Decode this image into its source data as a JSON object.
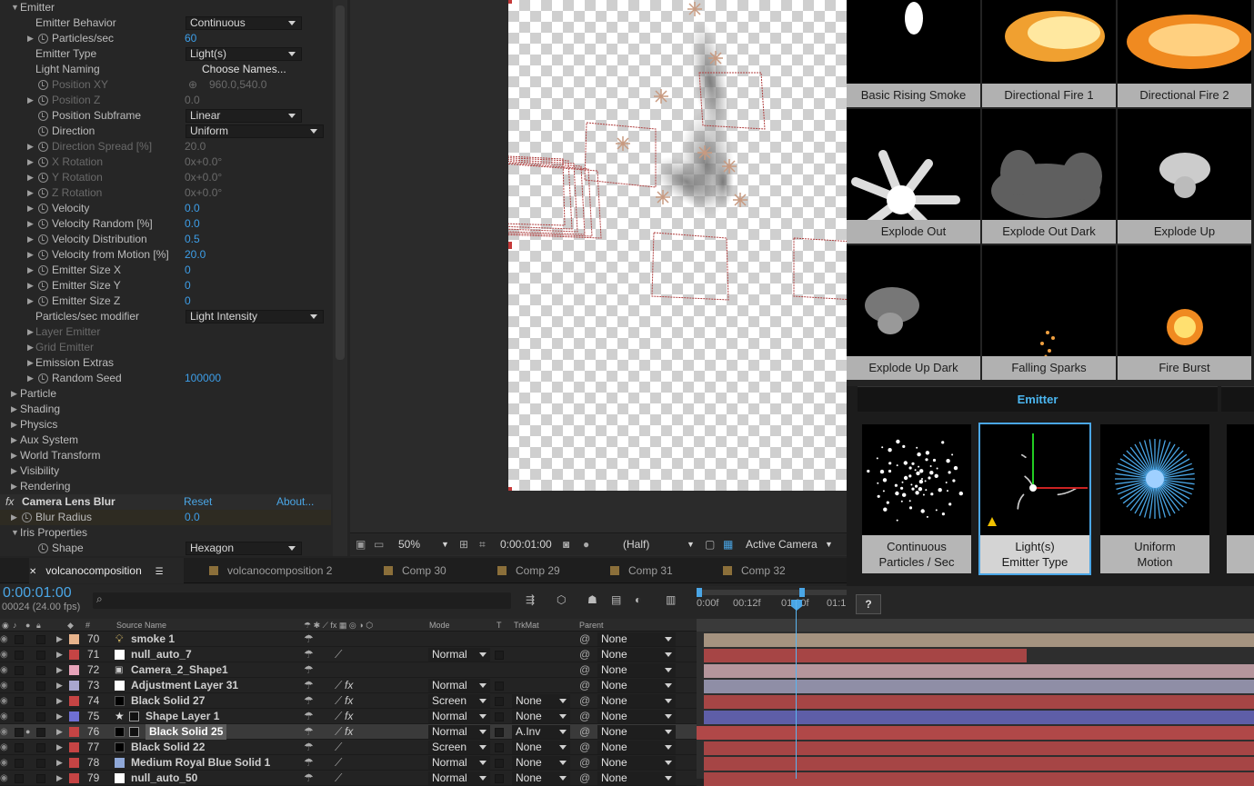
{
  "effect_controls": {
    "rows": [
      {
        "label": "Emitter",
        "twirl": "open",
        "indent": 0,
        "stopwatch": false
      },
      {
        "label": "Emitter Behavior",
        "indent": 2,
        "dropdown": "Continuous"
      },
      {
        "label": "Particles/sec",
        "twirl": "closed",
        "indent": 1,
        "stopwatch": true,
        "value": "60",
        "value_style": "blue"
      },
      {
        "label": "Emitter Type",
        "indent": 2,
        "dropdown": "Light(s)"
      },
      {
        "label": "Light Naming",
        "indent": 2,
        "button": "Choose Names..."
      },
      {
        "label": "Position XY",
        "indent": 1,
        "stopwatch": true,
        "disabled": true,
        "value": "960.0,540.0",
        "value_style": "dim",
        "crosshair": true
      },
      {
        "label": "Position Z",
        "twirl": "closed",
        "indent": 1,
        "stopwatch": true,
        "disabled": true,
        "value": "0.0",
        "value_style": "dim"
      },
      {
        "label": "Position Subframe",
        "indent": 1,
        "stopwatch": true,
        "dropdown": "Linear"
      },
      {
        "label": "Direction",
        "indent": 1,
        "stopwatch": true,
        "dropdown": "Uniform"
      },
      {
        "label": "Direction Spread [%]",
        "twirl": "closed",
        "indent": 1,
        "stopwatch": true,
        "disabled": true,
        "value": "20.0",
        "value_style": "dim"
      },
      {
        "label": "X Rotation",
        "twirl": "closed",
        "indent": 1,
        "stopwatch": true,
        "disabled": true,
        "value": "0x+0.0°",
        "value_style": "dim"
      },
      {
        "label": "Y Rotation",
        "twirl": "closed",
        "indent": 1,
        "stopwatch": true,
        "disabled": true,
        "value": "0x+0.0°",
        "value_style": "dim"
      },
      {
        "label": "Z Rotation",
        "twirl": "closed",
        "indent": 1,
        "stopwatch": true,
        "disabled": true,
        "value": "0x+0.0°",
        "value_style": "dim"
      },
      {
        "label": "Velocity",
        "twirl": "closed",
        "indent": 1,
        "stopwatch": true,
        "value": "0.0",
        "value_style": "blue"
      },
      {
        "label": "Velocity Random [%]",
        "twirl": "closed",
        "indent": 1,
        "stopwatch": true,
        "value": "0.0",
        "value_style": "blue"
      },
      {
        "label": "Velocity Distribution",
        "twirl": "closed",
        "indent": 1,
        "stopwatch": true,
        "value": "0.5",
        "value_style": "blue"
      },
      {
        "label": "Velocity from Motion [%]",
        "twirl": "closed",
        "indent": 1,
        "stopwatch": true,
        "value": "20.0",
        "value_style": "blue"
      },
      {
        "label": "Emitter Size X",
        "twirl": "closed",
        "indent": 1,
        "stopwatch": true,
        "value": "0",
        "value_style": "blue"
      },
      {
        "label": "Emitter Size Y",
        "twirl": "closed",
        "indent": 1,
        "stopwatch": true,
        "value": "0",
        "value_style": "blue"
      },
      {
        "label": "Emitter Size Z",
        "twirl": "closed",
        "indent": 1,
        "stopwatch": true,
        "value": "0",
        "value_style": "blue"
      },
      {
        "label": "Particles/sec modifier",
        "indent": 2,
        "dropdown": "Light Intensity"
      },
      {
        "label": "Layer Emitter",
        "twirl": "closed",
        "indent": 2,
        "disabled": true
      },
      {
        "label": "Grid Emitter",
        "twirl": "closed",
        "indent": 2,
        "disabled": true
      },
      {
        "label": "Emission Extras",
        "twirl": "closed",
        "indent": 2
      },
      {
        "label": "Random Seed",
        "twirl": "closed",
        "indent": 1,
        "stopwatch": true,
        "value": "100000",
        "value_style": "blue"
      },
      {
        "label": "Particle",
        "twirl": "closed",
        "indent": 0
      },
      {
        "label": "Shading",
        "twirl": "closed",
        "indent": 0
      },
      {
        "label": "Physics",
        "twirl": "closed",
        "indent": 0
      },
      {
        "label": "Aux System",
        "twirl": "closed",
        "indent": 0
      },
      {
        "label": "World Transform",
        "twirl": "closed",
        "indent": 0
      },
      {
        "label": "Visibility",
        "twirl": "closed",
        "indent": 0
      },
      {
        "label": "Rendering",
        "twirl": "closed",
        "indent": 0
      },
      {
        "label": "Camera Lens Blur",
        "fx": true,
        "indent": 0,
        "reset": "Reset",
        "about": "About..."
      },
      {
        "label": "Blur Radius",
        "twirl": "closed",
        "indent": 0,
        "stopwatch": true,
        "value": "0.0",
        "value_style": "blue"
      },
      {
        "label": "Iris Properties",
        "twirl": "open",
        "indent": 0
      },
      {
        "label": "Shape",
        "indent": 1,
        "stopwatch": true,
        "dropdown": "Hexagon"
      }
    ]
  },
  "viewer": {
    "zoom": "50%",
    "timecode": "0:00:01:00",
    "resolution": "(Half)",
    "camera": "Active Camera"
  },
  "presets": [
    {
      "label": "Basic Rising Smoke"
    },
    {
      "label": "Directional Fire 1"
    },
    {
      "label": "Directional Fire 2"
    },
    {
      "label": "Explode Out"
    },
    {
      "label": "Explode Out Dark"
    },
    {
      "label": "Explode Up"
    },
    {
      "label": "Explode Up Dark"
    },
    {
      "label": "Falling Sparks"
    },
    {
      "label": "Fire Burst"
    }
  ],
  "emitter_panel": {
    "title": "Emitter",
    "items": [
      {
        "line1": "Continuous",
        "line2": "Particles / Sec"
      },
      {
        "line1": "Light(s)",
        "line2": "Emitter Type"
      },
      {
        "line1": "Uniform",
        "line2": "Motion"
      }
    ],
    "help": "?"
  },
  "tabs": [
    {
      "label": "volcanocomposition",
      "active": true
    },
    {
      "label": "volcanocomposition 2"
    },
    {
      "label": "Comp 30"
    },
    {
      "label": "Comp 29"
    },
    {
      "label": "Comp 31"
    },
    {
      "label": "Comp 32"
    }
  ],
  "timeline": {
    "current_time": "0:00:01:00",
    "frame_info": "00024 (24.00 fps)",
    "columns": {
      "num": "#",
      "source": "Source Name",
      "mode": "Mode",
      "t": "T",
      "trkmat": "TrkMat",
      "parent": "Parent"
    },
    "ruler_ticks": [
      "0:00f",
      "00:12f",
      "01:00f",
      "01:1"
    ],
    "layers": [
      {
        "num": "70",
        "name": "smoke 1",
        "color": "#e8b48c",
        "mode": "",
        "trkmat": "",
        "parent": "None",
        "icon": "light"
      },
      {
        "num": "71",
        "name": "null_auto_7",
        "color": "#c54444",
        "mode": "Normal",
        "trkmat": "",
        "parent": "None",
        "icon": "white"
      },
      {
        "num": "72",
        "name": "Camera_2_Shape1",
        "color": "#e7a3b9",
        "mode": "",
        "trkmat": "",
        "parent": "None",
        "icon": "camera"
      },
      {
        "num": "73",
        "name": "Adjustment Layer 31",
        "color": "#a9a6cf",
        "mode": "Normal",
        "trkmat": "",
        "parent": "None",
        "icon": "white"
      },
      {
        "num": "74",
        "name": "Black Solid 27",
        "color": "#c54444",
        "mode": "Screen",
        "trkmat": "None",
        "parent": "None",
        "icon": "black"
      },
      {
        "num": "75",
        "name": "Shape Layer 1",
        "color": "#6f6fd4",
        "mode": "Normal",
        "trkmat": "None",
        "parent": "None",
        "icon": "shape"
      },
      {
        "num": "76",
        "name": "Black Solid 25",
        "color": "#c54444",
        "mode": "Normal",
        "trkmat": "A.Inv",
        "parent": "None",
        "icon": "black",
        "selected": true
      },
      {
        "num": "77",
        "name": "Black Solid 22",
        "color": "#c54444",
        "mode": "Screen",
        "trkmat": "None",
        "parent": "None",
        "icon": "black"
      },
      {
        "num": "78",
        "name": "Medium Royal Blue Solid 1",
        "color": "#c54444",
        "mode": "Normal",
        "trkmat": "None",
        "parent": "None",
        "icon": "blue"
      },
      {
        "num": "79",
        "name": "null_auto_50",
        "color": "#c54444",
        "mode": "Normal",
        "trkmat": "None",
        "parent": "None",
        "icon": "white"
      }
    ],
    "bar_colors": [
      "#a59380",
      "#a64545",
      "#b5959c",
      "#8f8ea6",
      "#a64545",
      "#5e5ea8",
      "#a64545",
      "#a64545",
      "#a64545",
      "#a64545"
    ]
  }
}
